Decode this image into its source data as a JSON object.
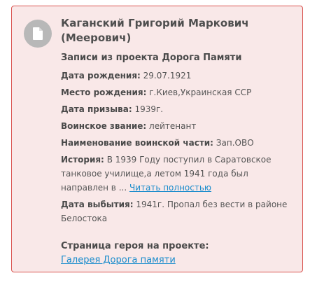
{
  "card": {
    "avatar_icon": "document-icon",
    "name": "Каганский Григорий Маркович (Меерович)",
    "section_title": "Записи из проекта Дорога Памяти",
    "fields": {
      "birth_date": {
        "label": "Дата рождения:",
        "value": "29.07.1921"
      },
      "birth_place": {
        "label": "Место рождения:",
        "value": "г.Киев,Украинская ССР"
      },
      "conscription_date": {
        "label": "Дата призыва:",
        "value": "1939г."
      },
      "military_rank": {
        "label": "Воинское звание:",
        "value": "лейтенант"
      },
      "military_unit": {
        "label": "Наименование воинской части:",
        "value": "Зап.ОВО"
      },
      "history": {
        "label": "История:",
        "value": "В 1939 Году поступил в Саратовское танковое училище,а летом 1941 года был направлен в ...",
        "read_more": "Читать полностью"
      },
      "leave_date": {
        "label": "Дата выбытия:",
        "value": "1941г. Пропал без вести в районе Белостока"
      }
    },
    "hero_page": {
      "title": "Страница героя на проекте:",
      "link": "Галерея Дорога памяти"
    }
  },
  "colors": {
    "card_background": "#f9e8e8",
    "card_border": "#d9534f",
    "link": "#1a8ccc",
    "avatar": "#b8b8b8"
  }
}
